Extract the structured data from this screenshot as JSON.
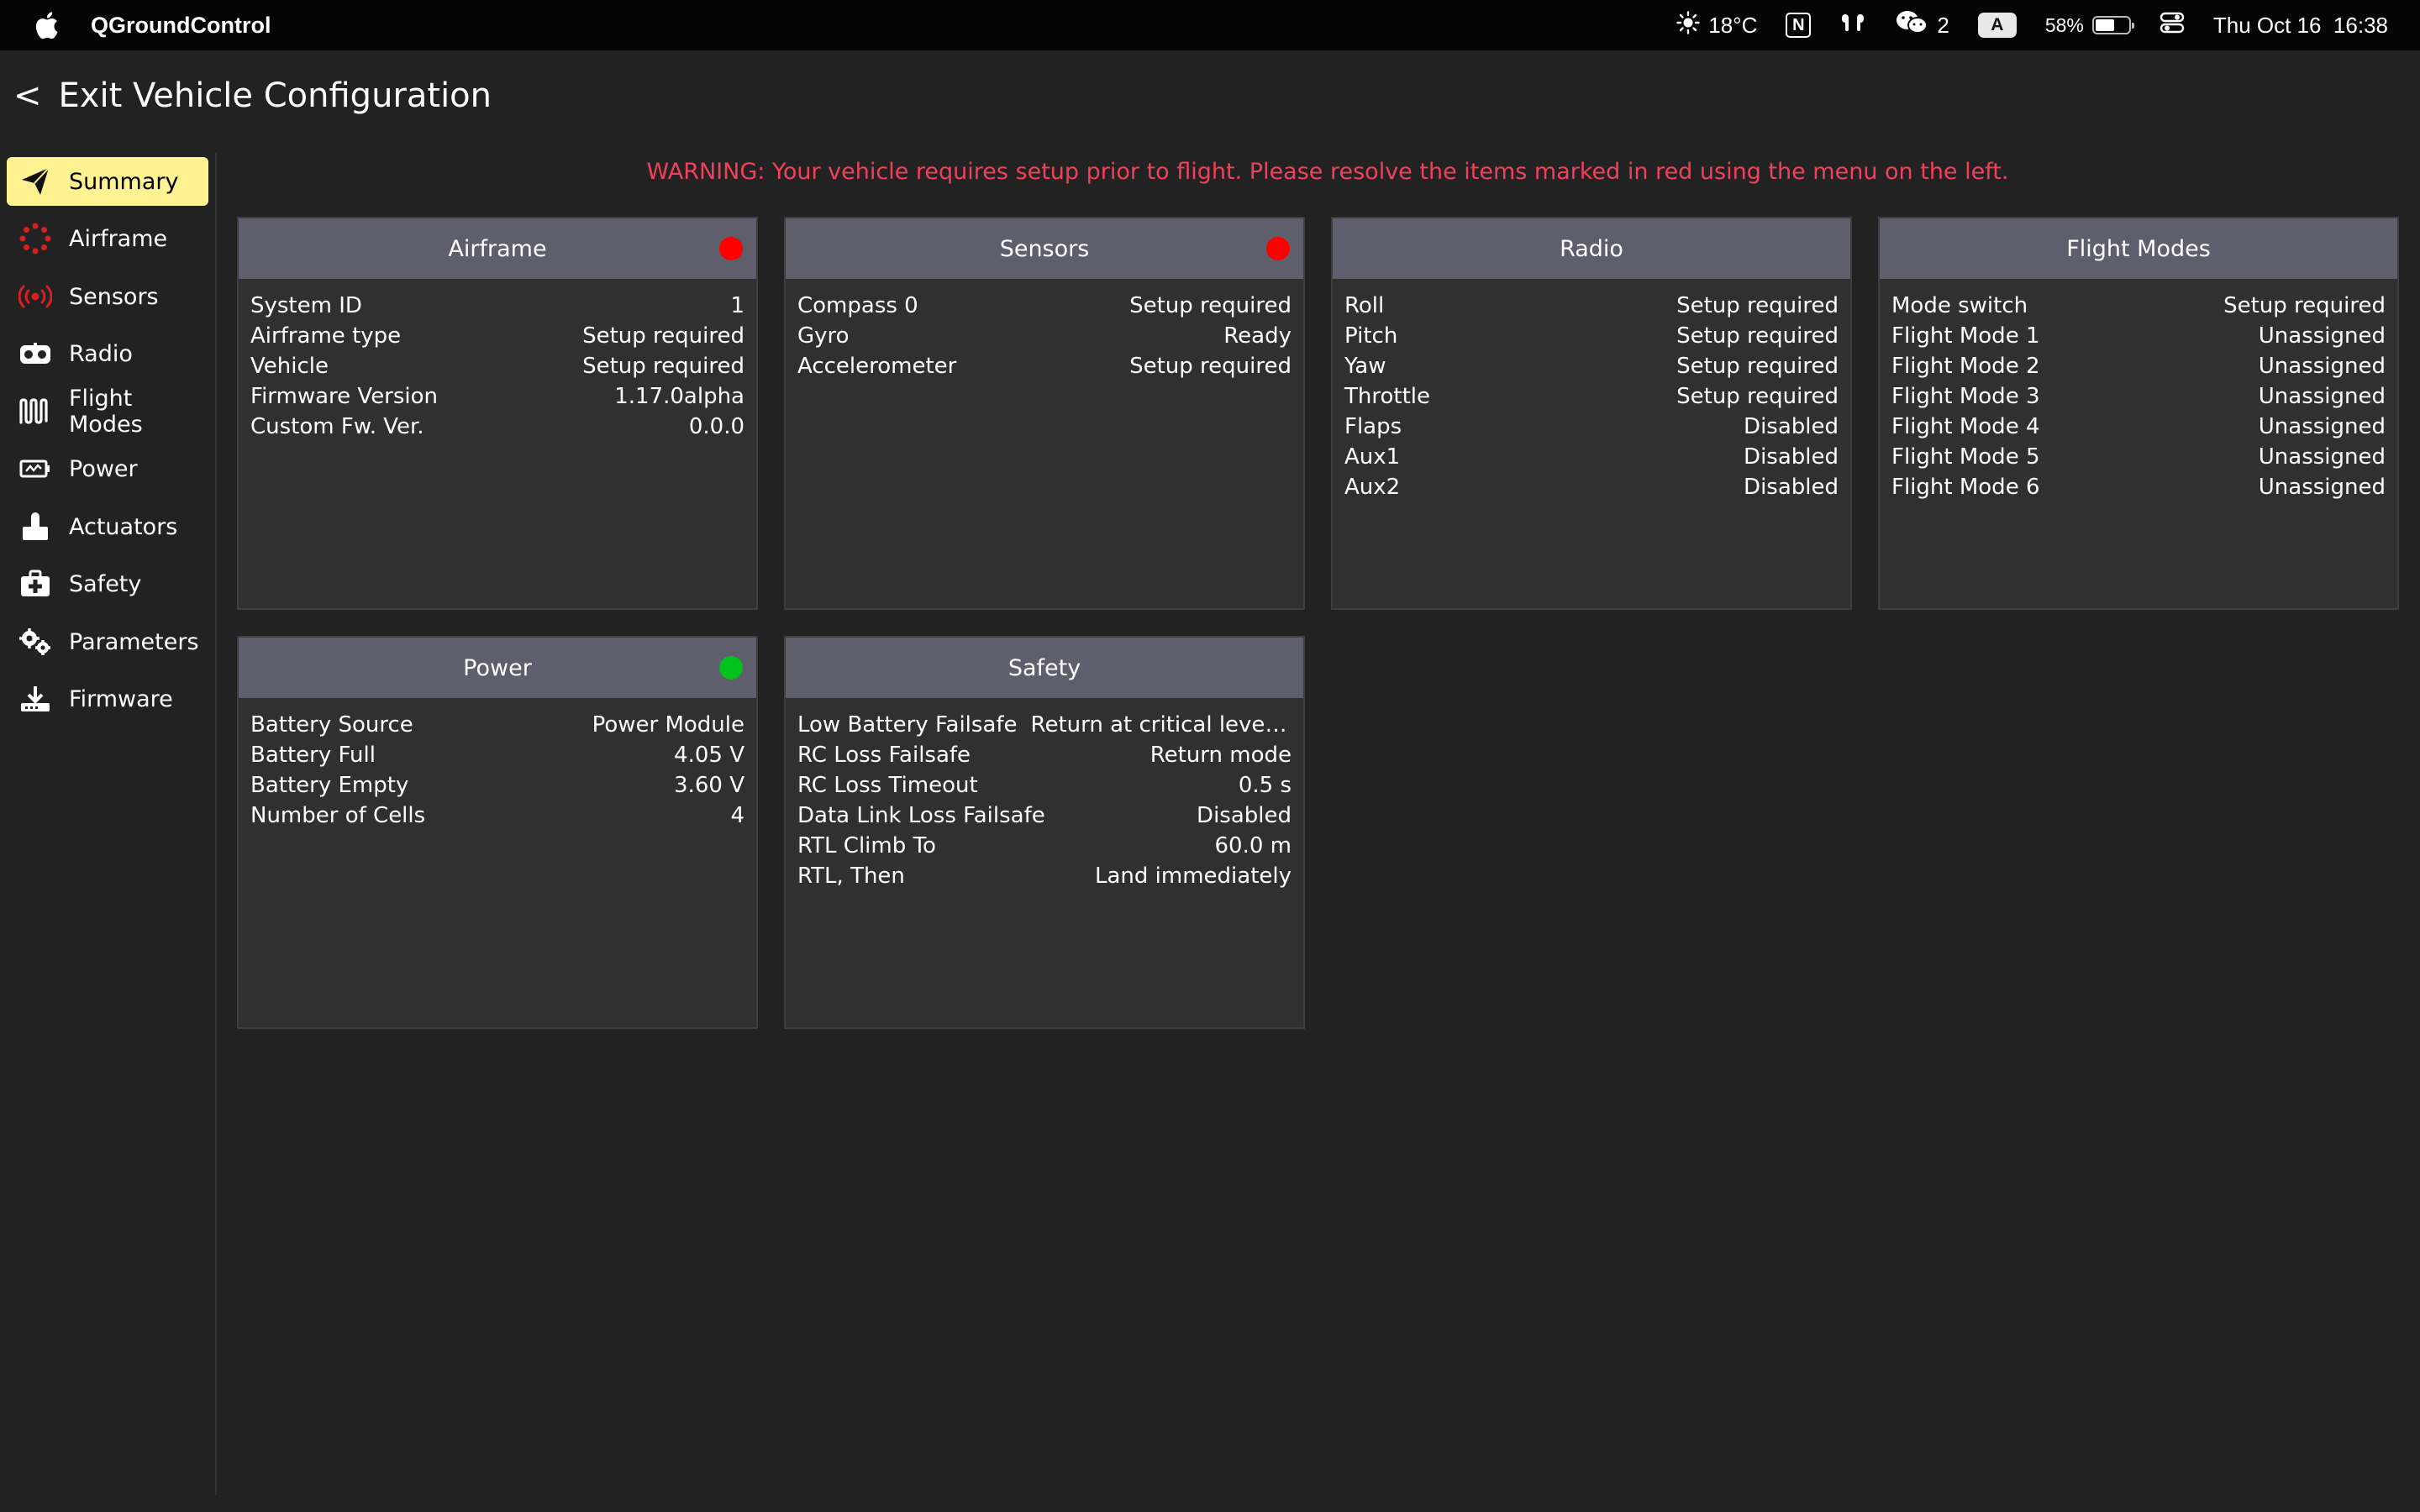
{
  "menubar": {
    "app_name": "QGroundControl",
    "weather": "18°C",
    "notion_letter": "N",
    "wechat_count": "2",
    "input_letter": "A",
    "battery_percent": "58%",
    "battery_level": 0.58,
    "datetime": "Thu Oct 16  16:38"
  },
  "header": {
    "back_glyph": "<",
    "title": "Exit Vehicle Configuration"
  },
  "sidebar": {
    "items": [
      {
        "label": "Summary",
        "icon": "paper-plane-icon",
        "active": true
      },
      {
        "label": "Airframe",
        "icon": "airframe-icon",
        "active": false
      },
      {
        "label": "Sensors",
        "icon": "sensors-icon",
        "active": false
      },
      {
        "label": "Radio",
        "icon": "radio-icon",
        "active": false
      },
      {
        "label": "Flight Modes",
        "icon": "flight-modes-icon",
        "active": false
      },
      {
        "label": "Power",
        "icon": "battery-icon",
        "active": false
      },
      {
        "label": "Actuators",
        "icon": "actuators-icon",
        "active": false
      },
      {
        "label": "Safety",
        "icon": "first-aid-kit-icon",
        "active": false
      },
      {
        "label": "Parameters",
        "icon": "gears-icon",
        "active": false
      },
      {
        "label": "Firmware",
        "icon": "firmware-upload-icon",
        "active": false
      }
    ]
  },
  "warning": "WARNING: Your vehicle requires setup prior to flight. Please resolve the items marked in red using the menu on the left.",
  "colors": {
    "accent_active": "#fff291",
    "warning_red": "#f0415b",
    "status_red": "#ff0000",
    "status_green": "#00c21a",
    "card_header": "#5e5e6c"
  },
  "cards": {
    "airframe": {
      "title": "Airframe",
      "status": "red",
      "rows": [
        {
          "k": "System ID",
          "v": "1"
        },
        {
          "k": "Airframe type",
          "v": "Setup required"
        },
        {
          "k": "Vehicle",
          "v": "Setup required"
        },
        {
          "k": "Firmware Version",
          "v": "1.17.0alpha"
        },
        {
          "k": "Custom Fw. Ver.",
          "v": "0.0.0"
        }
      ]
    },
    "sensors": {
      "title": "Sensors",
      "status": "red",
      "rows": [
        {
          "k": "Compass 0",
          "v": "Setup required"
        },
        {
          "k": "Gyro",
          "v": "Ready"
        },
        {
          "k": "Accelerometer",
          "v": "Setup required"
        }
      ]
    },
    "radio": {
      "title": "Radio",
      "rows": [
        {
          "k": "Roll",
          "v": "Setup required"
        },
        {
          "k": "Pitch",
          "v": "Setup required"
        },
        {
          "k": "Yaw",
          "v": "Setup required"
        },
        {
          "k": "Throttle",
          "v": "Setup required"
        },
        {
          "k": "Flaps",
          "v": "Disabled"
        },
        {
          "k": "Aux1",
          "v": "Disabled"
        },
        {
          "k": "Aux2",
          "v": "Disabled"
        }
      ]
    },
    "flight_modes": {
      "title": "Flight Modes",
      "rows": [
        {
          "k": "Mode switch",
          "v": "Setup required"
        },
        {
          "k": "Flight Mode 1",
          "v": "Unassigned"
        },
        {
          "k": "Flight Mode 2",
          "v": "Unassigned"
        },
        {
          "k": "Flight Mode 3",
          "v": "Unassigned"
        },
        {
          "k": "Flight Mode 4",
          "v": "Unassigned"
        },
        {
          "k": "Flight Mode 5",
          "v": "Unassigned"
        },
        {
          "k": "Flight Mode 6",
          "v": "Unassigned"
        }
      ]
    },
    "power": {
      "title": "Power",
      "status": "green",
      "rows": [
        {
          "k": "Battery Source",
          "v": "Power Module"
        },
        {
          "k": "Battery Full",
          "v": "4.05 V"
        },
        {
          "k": "Battery Empty",
          "v": "3.60 V"
        },
        {
          "k": "Number of Cells",
          "v": "4"
        }
      ]
    },
    "safety": {
      "title": "Safety",
      "rows": [
        {
          "k": "Low Battery Failsafe",
          "v": "Return at critical level, lan..."
        },
        {
          "k": "RC Loss Failsafe",
          "v": "Return mode"
        },
        {
          "k": "RC Loss Timeout",
          "v": "0.5 s"
        },
        {
          "k": "Data Link Loss Failsafe",
          "v": "Disabled"
        },
        {
          "k": "RTL Climb To",
          "v": "60.0 m"
        },
        {
          "k": "RTL, Then",
          "v": "Land immediately"
        }
      ]
    }
  }
}
